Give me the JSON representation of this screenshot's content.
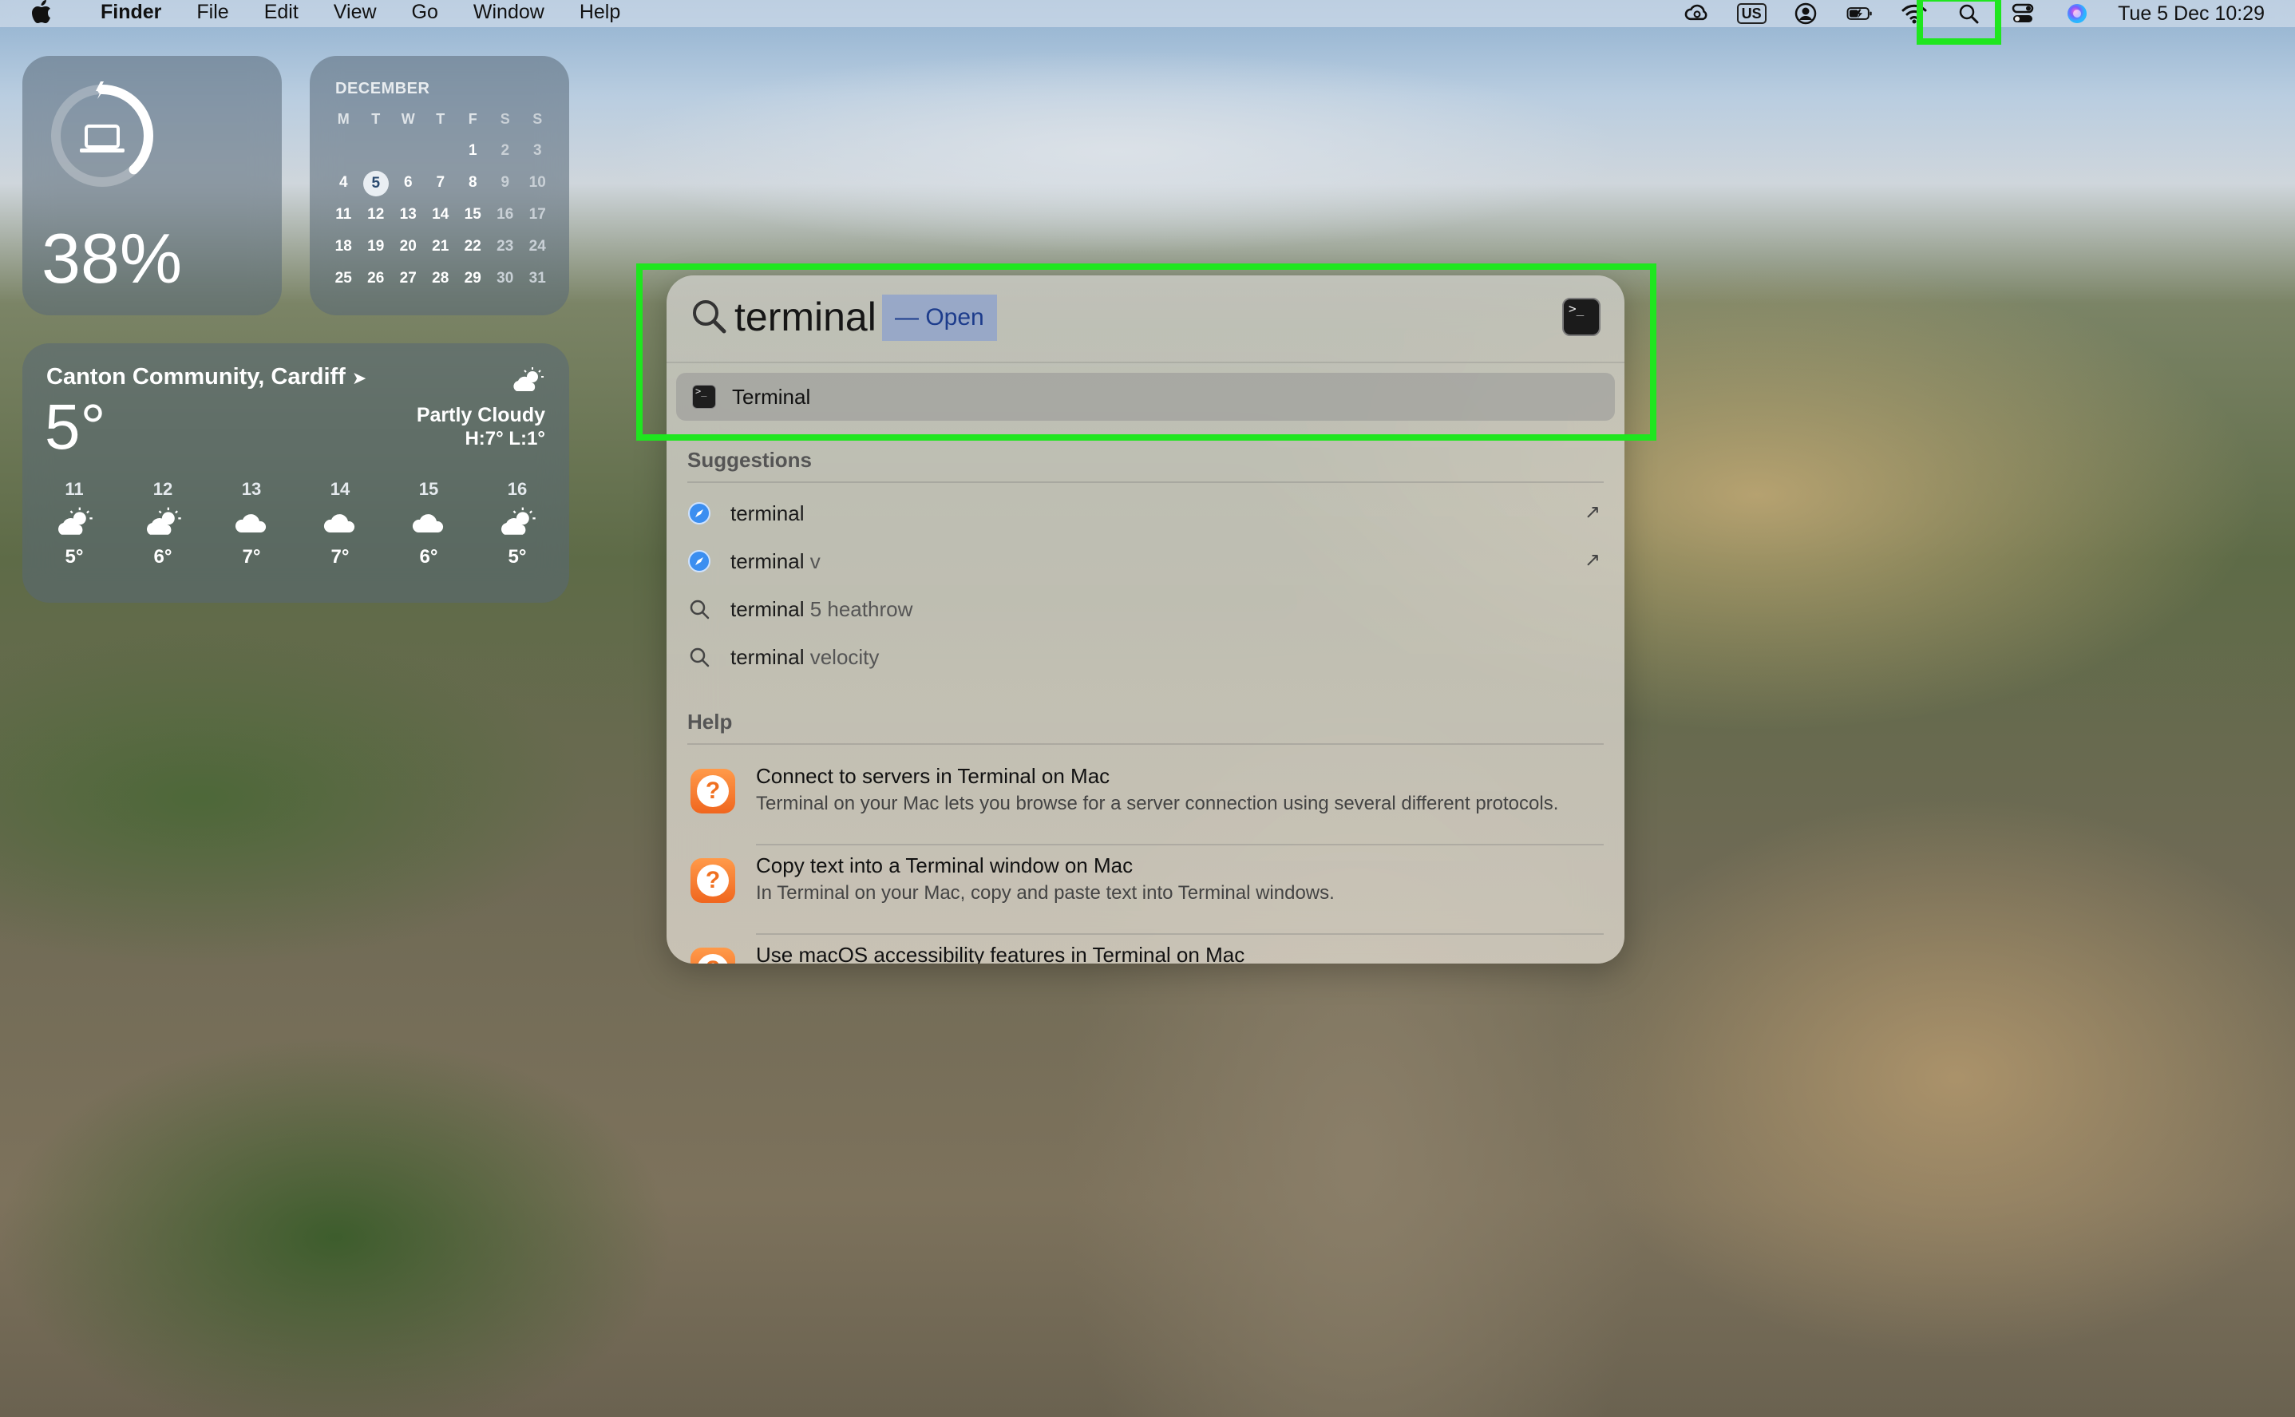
{
  "menubar": {
    "app_name": "Finder",
    "menus": [
      "File",
      "Edit",
      "View",
      "Go",
      "Window",
      "Help"
    ],
    "keyboard_layout": "US",
    "datetime": "Tue 5 Dec  10:29"
  },
  "battery_widget": {
    "percent_label": "38%",
    "level": 0.38
  },
  "calendar_widget": {
    "month": "DECEMBER",
    "weekdays": [
      "M",
      "T",
      "W",
      "T",
      "F",
      "S",
      "S"
    ],
    "days": [
      "",
      "",
      "",
      "",
      "1",
      "2",
      "3",
      "4",
      "5",
      "6",
      "7",
      "8",
      "9",
      "10",
      "11",
      "12",
      "13",
      "14",
      "15",
      "16",
      "17",
      "18",
      "19",
      "20",
      "21",
      "22",
      "23",
      "24",
      "25",
      "26",
      "27",
      "28",
      "29",
      "30",
      "31"
    ],
    "today": "5"
  },
  "weather_widget": {
    "location": "Canton Community, Cardiff",
    "temperature": "5°",
    "condition": "Partly Cloudy",
    "high_low": "H:7° L:1°",
    "forecast": [
      {
        "day": "11",
        "icon": "partly-cloudy-icon",
        "temp": "5°"
      },
      {
        "day": "12",
        "icon": "partly-cloudy-icon",
        "temp": "6°"
      },
      {
        "day": "13",
        "icon": "cloud-icon",
        "temp": "7°"
      },
      {
        "day": "14",
        "icon": "cloud-icon",
        "temp": "7°"
      },
      {
        "day": "15",
        "icon": "cloud-icon",
        "temp": "6°"
      },
      {
        "day": "16",
        "icon": "partly-cloudy-icon",
        "temp": "5°"
      }
    ]
  },
  "spotlight": {
    "query": "terminal",
    "completion_hint": "— Open",
    "top_hit": {
      "label": "Terminal",
      "icon": "terminal-app-icon"
    },
    "suggestions_header": "Suggestions",
    "suggestions": [
      {
        "icon": "safari-icon",
        "bold": "terminal",
        "rest": "",
        "has_arrow": true
      },
      {
        "icon": "safari-icon",
        "bold": "terminal",
        "rest": " v",
        "has_arrow": true
      },
      {
        "icon": "search-icon",
        "bold": "terminal",
        "rest": " 5 heathrow",
        "has_arrow": false
      },
      {
        "icon": "search-icon",
        "bold": "terminal",
        "rest": " velocity",
        "has_arrow": false
      }
    ],
    "help_header": "Help",
    "help_items": [
      {
        "title": "Connect to servers in Terminal on Mac",
        "desc": "Terminal on your Mac lets you browse for a server connection using several different protocols."
      },
      {
        "title": "Copy text into a Terminal window on Mac",
        "desc": "In Terminal on your Mac, copy and paste text into Terminal windows."
      },
      {
        "title": "Use macOS accessibility features in Terminal on Mac",
        "desc": ""
      }
    ]
  },
  "colors": {
    "highlight_box": "#1fe61f",
    "hint_bg": "#8ca0cd",
    "help_icon": "#f0661e"
  }
}
